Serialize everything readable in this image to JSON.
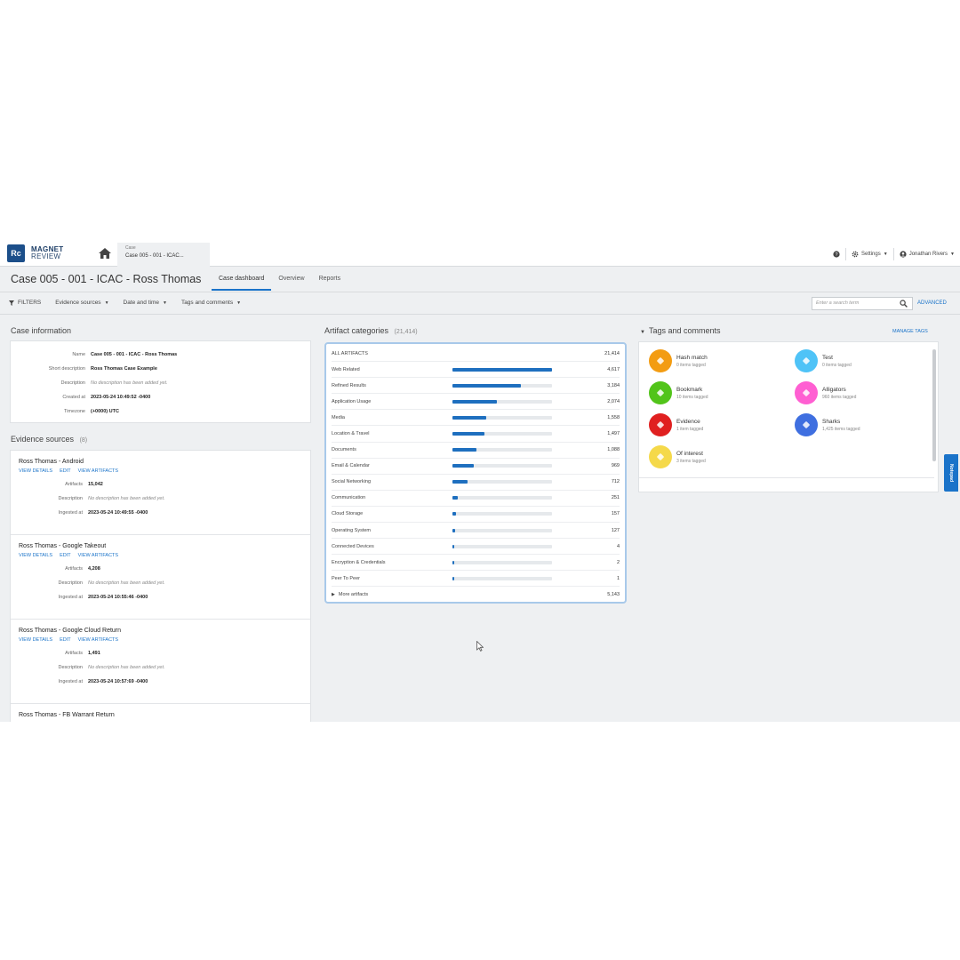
{
  "app": {
    "logo_text": "Rc",
    "brand_line1": "MAGNET",
    "brand_line2": "REVIEW",
    "case_tab_label": "Case",
    "case_tab_value": "Case 005 - 001 - ICAC..."
  },
  "topbar": {
    "settings_label": "Settings",
    "user_label": "Jonathan Rivers"
  },
  "header": {
    "title": "Case 005 - 001 - ICAC - Ross Thomas",
    "tabs": [
      {
        "label": "Case dashboard",
        "active": true
      },
      {
        "label": "Overview",
        "active": false
      },
      {
        "label": "Reports",
        "active": false
      }
    ]
  },
  "filters": {
    "filters_label": "FILTERS",
    "items": [
      "Evidence sources",
      "Date and time",
      "Tags and comments"
    ],
    "search_placeholder": "Enter a search term",
    "advanced_label": "ADVANCED"
  },
  "case_info": {
    "heading": "Case information",
    "rows": [
      {
        "key": "Name",
        "value": "Case 005 - 001 - ICAC - Ross Thomas",
        "italic": false
      },
      {
        "key": "Short description",
        "value": "Ross Thomas Case Example",
        "italic": false
      },
      {
        "key": "Description",
        "value": "No description has been added yet.",
        "italic": true
      },
      {
        "key": "Created at",
        "value": "2023-05-24 10:49:52 -0400",
        "italic": false
      },
      {
        "key": "Timezone",
        "value": "(+0000) UTC",
        "italic": false
      }
    ]
  },
  "evidence": {
    "heading": "Evidence sources",
    "count": "(8)",
    "link_details": "VIEW DETAILS",
    "link_edit": "EDIT",
    "link_artifacts": "VIEW ARTIFACTS",
    "key_artifacts": "Artifacts",
    "key_description": "Description",
    "key_ingested": "Ingested at",
    "sources": [
      {
        "name": "Ross Thomas - Android",
        "artifacts": "15,042",
        "description": "No description has been added yet.",
        "ingested": "2023-05-24 10:49:55 -0400"
      },
      {
        "name": "Ross Thomas - Google Takeout",
        "artifacts": "4,208",
        "description": "No description has been added yet.",
        "ingested": "2023-05-24 10:55:46 -0400"
      },
      {
        "name": "Ross Thomas - Google Cloud Return",
        "artifacts": "1,491",
        "description": "No description has been added yet.",
        "ingested": "2023-05-24 10:57:69 -0400"
      },
      {
        "name": "Ross Thomas - FB Warrant Return",
        "artifacts": "",
        "description": "",
        "ingested": ""
      }
    ]
  },
  "artifacts": {
    "heading": "Artifact categories",
    "total_count": "(21,414)",
    "all_label": "ALL ARTIFACTS",
    "all_value": "21,414",
    "categories": [
      {
        "name": "Web Related",
        "value": "4,617",
        "fraction": 1.0
      },
      {
        "name": "Refined Results",
        "value": "3,184",
        "fraction": 0.69
      },
      {
        "name": "Application Usage",
        "value": "2,074",
        "fraction": 0.45
      },
      {
        "name": "Media",
        "value": "1,558",
        "fraction": 0.34
      },
      {
        "name": "Location & Travel",
        "value": "1,497",
        "fraction": 0.32
      },
      {
        "name": "Documents",
        "value": "1,088",
        "fraction": 0.24
      },
      {
        "name": "Email & Calendar",
        "value": "969",
        "fraction": 0.21
      },
      {
        "name": "Social Networking",
        "value": "712",
        "fraction": 0.15
      },
      {
        "name": "Communication",
        "value": "251",
        "fraction": 0.055
      },
      {
        "name": "Cloud Storage",
        "value": "157",
        "fraction": 0.034
      },
      {
        "name": "Operating System",
        "value": "127",
        "fraction": 0.028
      },
      {
        "name": "Connected Devices",
        "value": "4",
        "fraction": 0.01
      },
      {
        "name": "Encryption & Credentials",
        "value": "2",
        "fraction": 0.01
      },
      {
        "name": "Peer To Peer",
        "value": "1",
        "fraction": 0.01
      }
    ],
    "more_label": "More artifacts",
    "more_value": "5,143"
  },
  "tags": {
    "heading": "Tags and comments",
    "manage_label": "MANAGE TAGS",
    "items": [
      {
        "name": "Hash match",
        "count": "0 items tagged",
        "color": "#f39c12"
      },
      {
        "name": "Test",
        "count": "0 items tagged",
        "color": "#4fc3f7"
      },
      {
        "name": "Bookmark",
        "count": "10 items tagged",
        "color": "#52c41a"
      },
      {
        "name": "Alligators",
        "count": "960 items tagged",
        "color": "#ff5fd2"
      },
      {
        "name": "Evidence",
        "count": "1 item tagged",
        "color": "#e02020"
      },
      {
        "name": "Sharks",
        "count": "1,425 items tagged",
        "color": "#3f6fe0"
      },
      {
        "name": "Of interest",
        "count": "3 items tagged",
        "color": "#f5d94a"
      }
    ]
  },
  "side_tab": {
    "label": "Notepad"
  }
}
